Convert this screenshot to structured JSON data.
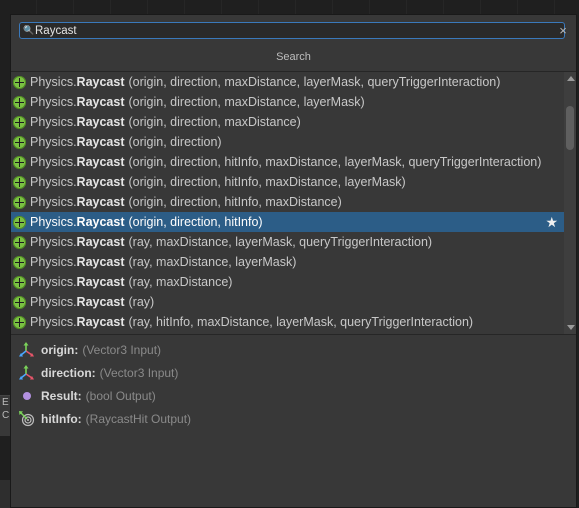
{
  "search": {
    "value": "Raycast",
    "icon": "search-icon"
  },
  "close_label": "×",
  "header": {
    "title": "Search"
  },
  "results": [
    {
      "class": "Physics.",
      "method": "Raycast",
      "args": "(origin, direction, maxDistance, layerMask, queryTriggerInteraction)",
      "selected": false
    },
    {
      "class": "Physics.",
      "method": "Raycast",
      "args": "(origin, direction, maxDistance, layerMask)",
      "selected": false
    },
    {
      "class": "Physics.",
      "method": "Raycast",
      "args": "(origin, direction, maxDistance)",
      "selected": false
    },
    {
      "class": "Physics.",
      "method": "Raycast",
      "args": "(origin, direction)",
      "selected": false
    },
    {
      "class": "Physics.",
      "method": "Raycast",
      "args": "(origin, direction, hitInfo, maxDistance, layerMask, queryTriggerInteraction)",
      "selected": false
    },
    {
      "class": "Physics.",
      "method": "Raycast",
      "args": "(origin, direction, hitInfo, maxDistance, layerMask)",
      "selected": false
    },
    {
      "class": "Physics.",
      "method": "Raycast",
      "args": "(origin, direction, hitInfo, maxDistance)",
      "selected": false
    },
    {
      "class": "Physics.",
      "method": "Raycast",
      "args": "(origin, direction, hitInfo)",
      "selected": true,
      "favorite": "★"
    },
    {
      "class": "Physics.",
      "method": "Raycast",
      "args": "(ray, maxDistance, layerMask, queryTriggerInteraction)",
      "selected": false
    },
    {
      "class": "Physics.",
      "method": "Raycast",
      "args": "(ray, maxDistance, layerMask)",
      "selected": false
    },
    {
      "class": "Physics.",
      "method": "Raycast",
      "args": "(ray, maxDistance)",
      "selected": false
    },
    {
      "class": "Physics.",
      "method": "Raycast",
      "args": "(ray)",
      "selected": false
    },
    {
      "class": "Physics.",
      "method": "Raycast",
      "args": "(ray, hitInfo, maxDistance, layerMask, queryTriggerInteraction)",
      "selected": false
    }
  ],
  "ports": [
    {
      "name": "origin:",
      "type": "(Vector3 Input)",
      "icon": "axis-arrows-icon"
    },
    {
      "name": "direction:",
      "type": "(Vector3 Input)",
      "icon": "axis-arrows-icon"
    },
    {
      "name": "Result:",
      "type": "(bool Output)",
      "icon": "purple-dot-icon"
    },
    {
      "name": "hitInfo:",
      "type": "(RaycastHit Output)",
      "icon": "raycast-hit-icon"
    }
  ],
  "background": {
    "left_text_1": "E",
    "left_text_2": "C"
  },
  "colors": {
    "selection": "#2c5d87",
    "node_icon": "#7bc043",
    "search_border": "#3a79bb",
    "bool_port": "#b391e0"
  }
}
